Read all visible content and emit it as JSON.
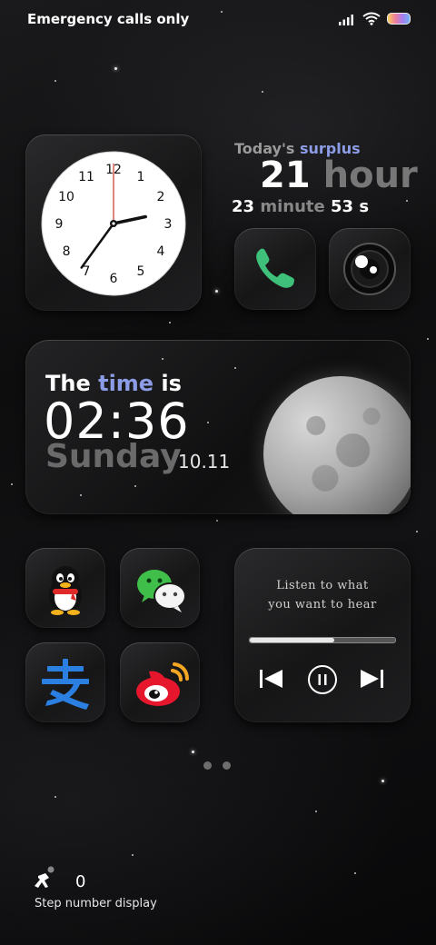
{
  "status_bar": {
    "carrier_text": "Emergency calls only"
  },
  "clock": {
    "numbers": [
      "12",
      "1",
      "2",
      "3",
      "4",
      "5",
      "6",
      "7",
      "8",
      "9",
      "10",
      "11"
    ],
    "hour": 2,
    "minute": 36
  },
  "surplus": {
    "title_prefix": "Today's ",
    "title_accent": "surplus",
    "hours_value": "21",
    "hours_unit": "hour",
    "minutes_value": "23",
    "minutes_unit": "minute",
    "seconds_value": "53",
    "seconds_unit": "s"
  },
  "apps": {
    "phone": "phone-app",
    "camera": "camera-app",
    "qq": "qq-app",
    "wechat": "wechat-app",
    "alipay": "alipay-app",
    "weibo": "weibo-app"
  },
  "time_widget": {
    "label_prefix": "The ",
    "label_accent": "time",
    "label_suffix": " is",
    "time": "02:36",
    "day": "Sunday",
    "date": "10.11"
  },
  "music": {
    "line1": "Listen to what",
    "line2": "you want to hear",
    "progress": 0.58
  },
  "steps": {
    "count": "0",
    "label": "Step number display"
  },
  "colors": {
    "accent": "#8c9ce6",
    "phone_green": "#3ec07a"
  }
}
